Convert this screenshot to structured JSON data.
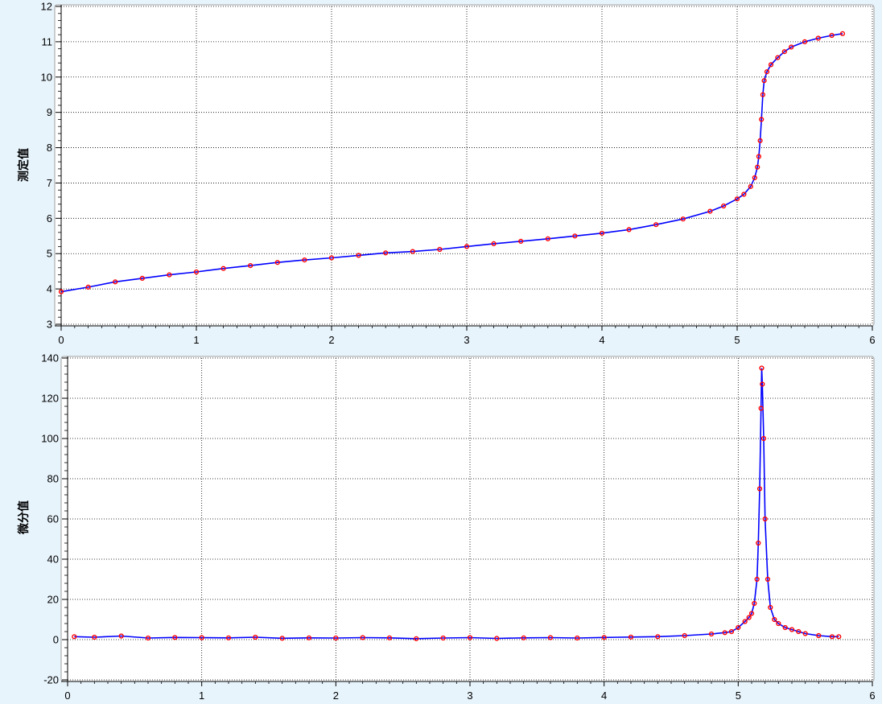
{
  "colors": {
    "background": "#e8f4fc",
    "plot_area": "#ffffff",
    "grid": "#000000",
    "line": "#0000ff",
    "marker": "#ff0000"
  },
  "chart_data": [
    {
      "type": "line",
      "title": "",
      "xlabel": "",
      "ylabel": "测定值",
      "xlim": [
        0,
        6
      ],
      "ylim": [
        3,
        12
      ],
      "x_ticks": [
        "0",
        "1",
        "2",
        "3",
        "4",
        "5",
        "6"
      ],
      "y_ticks": [
        "3",
        "4",
        "5",
        "6",
        "7",
        "8",
        "9",
        "10",
        "11",
        "12"
      ],
      "grid": true,
      "legend": "none",
      "markers": "circle",
      "series": [
        {
          "x": [
            0.0,
            0.2,
            0.4,
            0.6,
            0.8,
            1.0,
            1.2,
            1.4,
            1.6,
            1.8,
            2.0,
            2.2,
            2.4,
            2.6,
            2.8,
            3.0,
            3.2,
            3.4,
            3.6,
            3.8,
            4.0,
            4.2,
            4.4,
            4.6,
            4.8,
            4.9,
            5.0,
            5.05,
            5.1,
            5.13,
            5.15,
            5.16,
            5.17,
            5.18,
            5.19,
            5.2,
            5.22,
            5.25,
            5.3,
            5.35,
            5.4,
            5.5,
            5.6,
            5.7,
            5.78
          ],
          "values": [
            3.92,
            4.05,
            4.2,
            4.3,
            4.4,
            4.48,
            4.58,
            4.66,
            4.75,
            4.82,
            4.88,
            4.95,
            5.02,
            5.06,
            5.12,
            5.2,
            5.28,
            5.35,
            5.42,
            5.5,
            5.58,
            5.68,
            5.82,
            5.98,
            6.2,
            6.35,
            6.55,
            6.68,
            6.9,
            7.15,
            7.45,
            7.75,
            8.2,
            8.8,
            9.5,
            9.9,
            10.15,
            10.35,
            10.55,
            10.72,
            10.85,
            11.0,
            11.1,
            11.18,
            11.23
          ]
        }
      ]
    },
    {
      "type": "line",
      "title": "",
      "xlabel": "",
      "ylabel": "微分值",
      "xlim": [
        0,
        6
      ],
      "ylim": [
        -20,
        140
      ],
      "x_ticks": [
        "0",
        "1",
        "2",
        "3",
        "4",
        "5",
        "6"
      ],
      "y_ticks": [
        "-20",
        "0",
        "20",
        "40",
        "60",
        "80",
        "100",
        "120",
        "140"
      ],
      "grid": true,
      "legend": "none",
      "markers": "circle",
      "series": [
        {
          "x": [
            0.05,
            0.2,
            0.4,
            0.6,
            0.8,
            1.0,
            1.2,
            1.4,
            1.6,
            1.8,
            2.0,
            2.2,
            2.4,
            2.6,
            2.8,
            3.0,
            3.2,
            3.4,
            3.6,
            3.8,
            4.0,
            4.2,
            4.4,
            4.6,
            4.8,
            4.9,
            4.95,
            5.0,
            5.05,
            5.08,
            5.1,
            5.12,
            5.14,
            5.15,
            5.16,
            5.17,
            5.175,
            5.18,
            5.19,
            5.2,
            5.22,
            5.24,
            5.27,
            5.3,
            5.35,
            5.4,
            5.45,
            5.5,
            5.6,
            5.7,
            5.75
          ],
          "values": [
            1.5,
            1.2,
            1.8,
            0.8,
            1.1,
            1.0,
            0.9,
            1.2,
            0.7,
            0.9,
            0.8,
            1.0,
            0.9,
            0.5,
            0.8,
            1.0,
            0.6,
            0.9,
            1.0,
            0.8,
            1.1,
            1.3,
            1.5,
            2.0,
            2.8,
            3.5,
            4.0,
            6.0,
            9.0,
            11.0,
            13.0,
            18.0,
            30.0,
            48.0,
            75.0,
            115.0,
            135.0,
            127.0,
            100.0,
            60.0,
            30.0,
            16.0,
            10.0,
            8.0,
            6.0,
            5.0,
            4.0,
            3.0,
            2.0,
            1.5,
            1.5
          ]
        }
      ]
    }
  ]
}
